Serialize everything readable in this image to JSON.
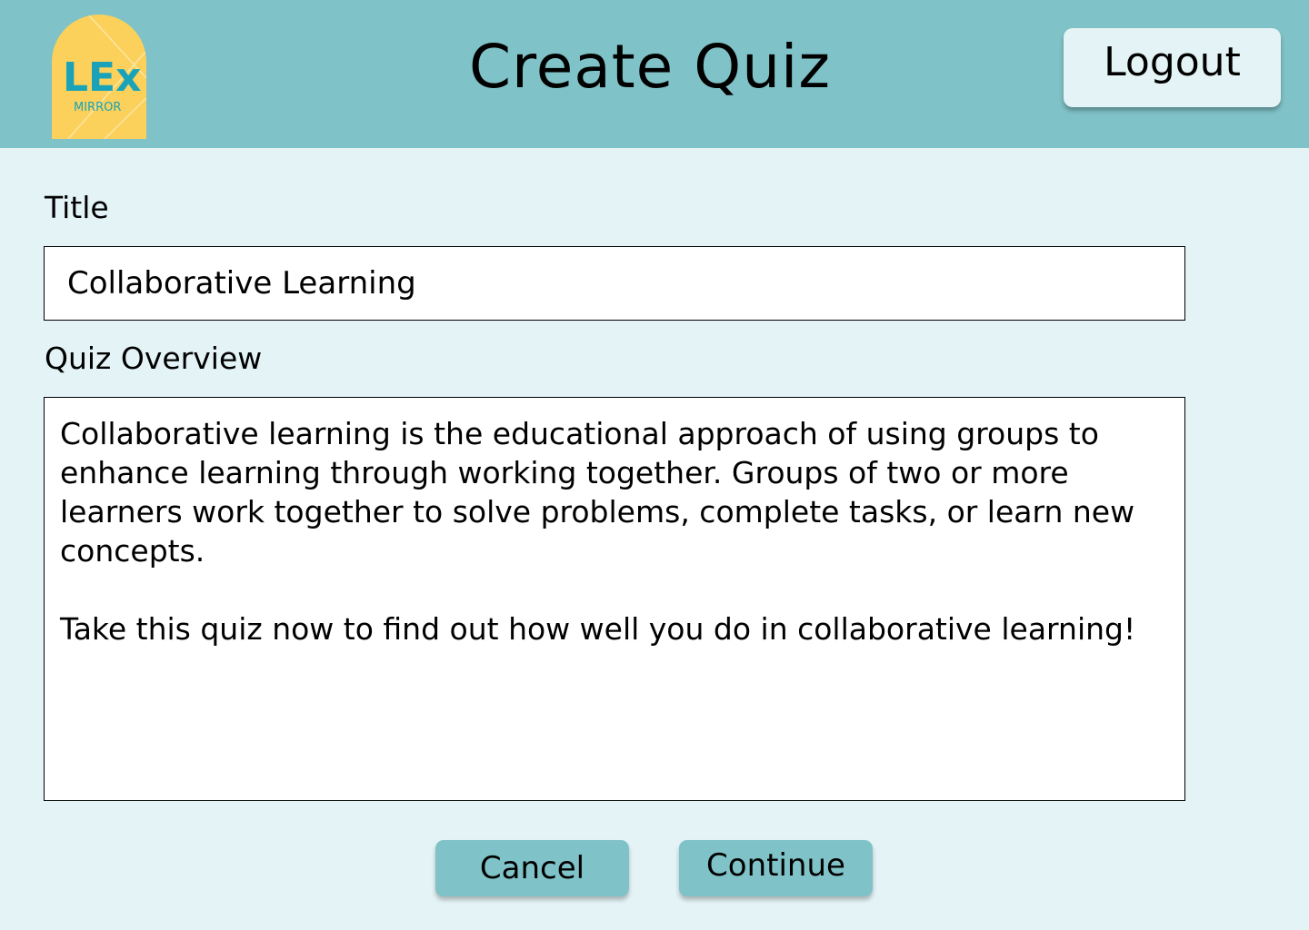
{
  "header": {
    "logo": {
      "brand": "LEx",
      "sub": "MIRROR",
      "color": "#fbd15b",
      "text_color": "#1aa3b8"
    },
    "title": "Create Quiz",
    "logout_label": "Logout"
  },
  "form": {
    "title_label": "Title",
    "title_value": "Collaborative Learning",
    "overview_label": "Quiz Overview",
    "overview_value": "Collaborative learning is the educational approach of using groups to enhance learning through working together. Groups of two or more learners work together to solve problems, complete tasks, or learn new concepts.\n\nTake this quiz now to find out how well you do in collaborative learning!"
  },
  "actions": {
    "cancel_label": "Cancel",
    "continue_label": "Continue"
  },
  "colors": {
    "header_bg": "#7fc2c7",
    "page_bg": "#e4f3f6",
    "button_bg": "#7fc2c7",
    "logout_bg": "#e4f3f6"
  }
}
